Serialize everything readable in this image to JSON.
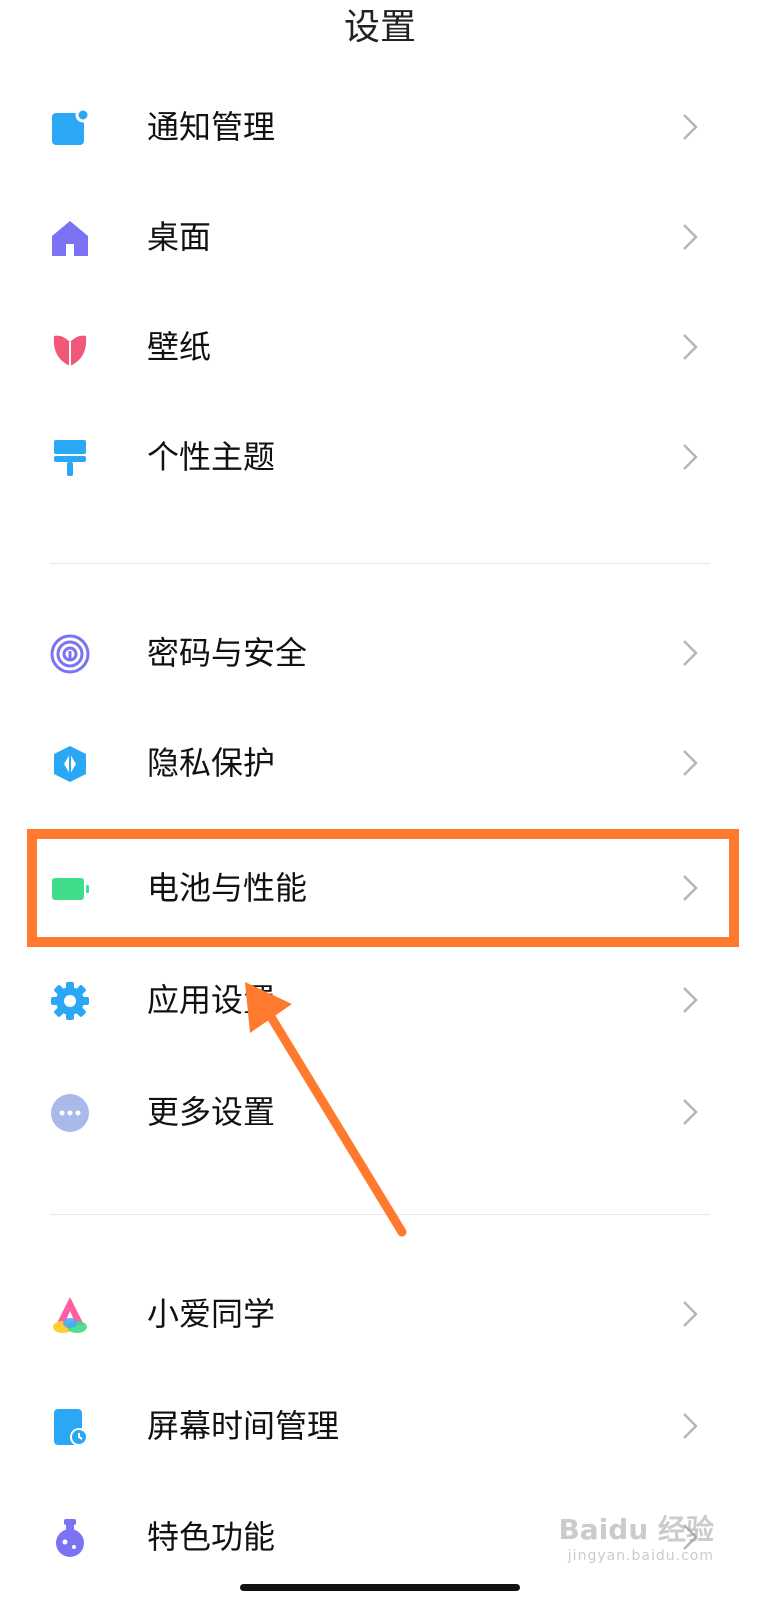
{
  "title": "设置",
  "rows": [
    {
      "label": "通知管理",
      "icon": "notification-icon"
    },
    {
      "label": "桌面",
      "icon": "home-icon"
    },
    {
      "label": "壁纸",
      "icon": "wallpaper-icon"
    },
    {
      "label": "个性主题",
      "icon": "theme-brush-icon"
    },
    {
      "label": "密码与安全",
      "icon": "fingerprint-icon"
    },
    {
      "label": "隐私保护",
      "icon": "privacy-shield-icon"
    },
    {
      "label": "电池与性能",
      "icon": "battery-icon"
    },
    {
      "label": "应用设置",
      "icon": "app-settings-gear-icon"
    },
    {
      "label": "更多设置",
      "icon": "more-dots-icon"
    },
    {
      "label": "小爱同学",
      "icon": "xiaoai-assistant-icon"
    },
    {
      "label": "屏幕时间管理",
      "icon": "screen-time-icon"
    },
    {
      "label": "特色功能",
      "icon": "special-features-flask-icon"
    }
  ],
  "annotation": {
    "highlight_color": "#ff7a2e",
    "highlighted_item": "电池与性能"
  },
  "watermark": {
    "main": "Baidu 经验",
    "sub": "jingyan.baidu.com"
  }
}
